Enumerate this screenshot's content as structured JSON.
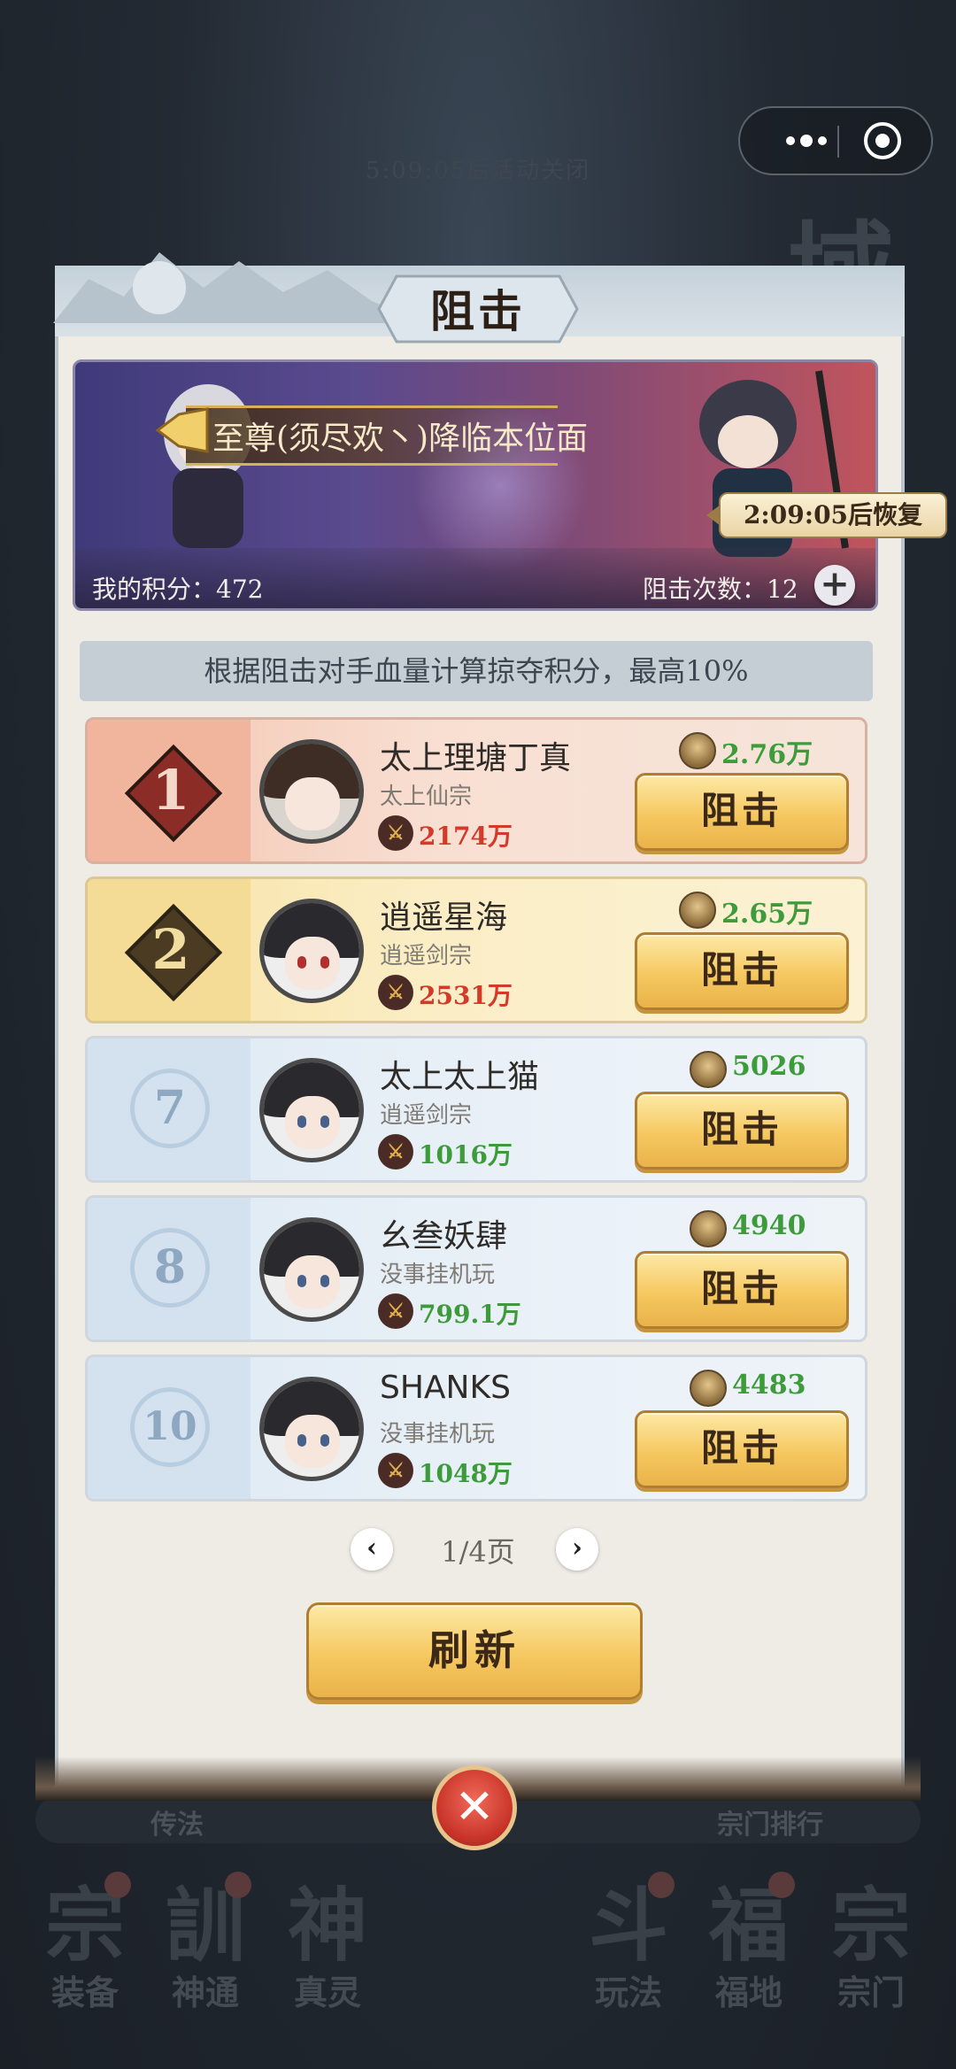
{
  "background": {
    "timer_text": "5:09:05后活动关闭",
    "tab_left": "传法",
    "tab_right": "宗门排行",
    "nav": [
      {
        "glyph": "宗",
        "label": "装备"
      },
      {
        "glyph": "訓",
        "label": "神通"
      },
      {
        "glyph": "神",
        "label": "真灵"
      },
      {
        "glyph": "斗",
        "label": "玩法"
      },
      {
        "glyph": "福",
        "label": "福地"
      },
      {
        "glyph": "宗",
        "label": "宗门"
      }
    ]
  },
  "dialog": {
    "title": "阻击",
    "announcement": "至尊(须尽欢丶)降临本位面",
    "my_score_label": "我的积分：472",
    "block_count_label": "阻击次数：12",
    "recover_text": "2:09:05后恢复",
    "plus_symbol": "+",
    "notice": "根据阻击对手血量计算掠夺积分，最高10%",
    "block_button_label": "阻击",
    "rows": [
      {
        "rank": "1",
        "name": "太上理塘丁真",
        "sect": "太上仙宗",
        "power": "2174万",
        "score": "2.76万"
      },
      {
        "rank": "2",
        "name": "逍遥星海",
        "sect": "逍遥剑宗",
        "power": "2531万",
        "score": "2.65万"
      },
      {
        "rank": "7",
        "name": "太上太上猫",
        "sect": "逍遥剑宗",
        "power": "1016万",
        "score": "5026"
      },
      {
        "rank": "8",
        "name": "幺叁妖肆",
        "sect": "没事挂机玩",
        "power": "799.1万",
        "score": "4940"
      },
      {
        "rank": "10",
        "name": "SHANKS",
        "sect": "没事挂机玩",
        "power": "1048万",
        "score": "4483"
      }
    ],
    "page_label": "1/4页",
    "prev_symbol": "‹",
    "next_symbol": "›",
    "refresh_label": "刷新",
    "close_symbol": "✕"
  },
  "colors": {
    "power_red": "#d23a2a",
    "score_green": "#3e9b3c",
    "button_gold": "#f6c860"
  }
}
